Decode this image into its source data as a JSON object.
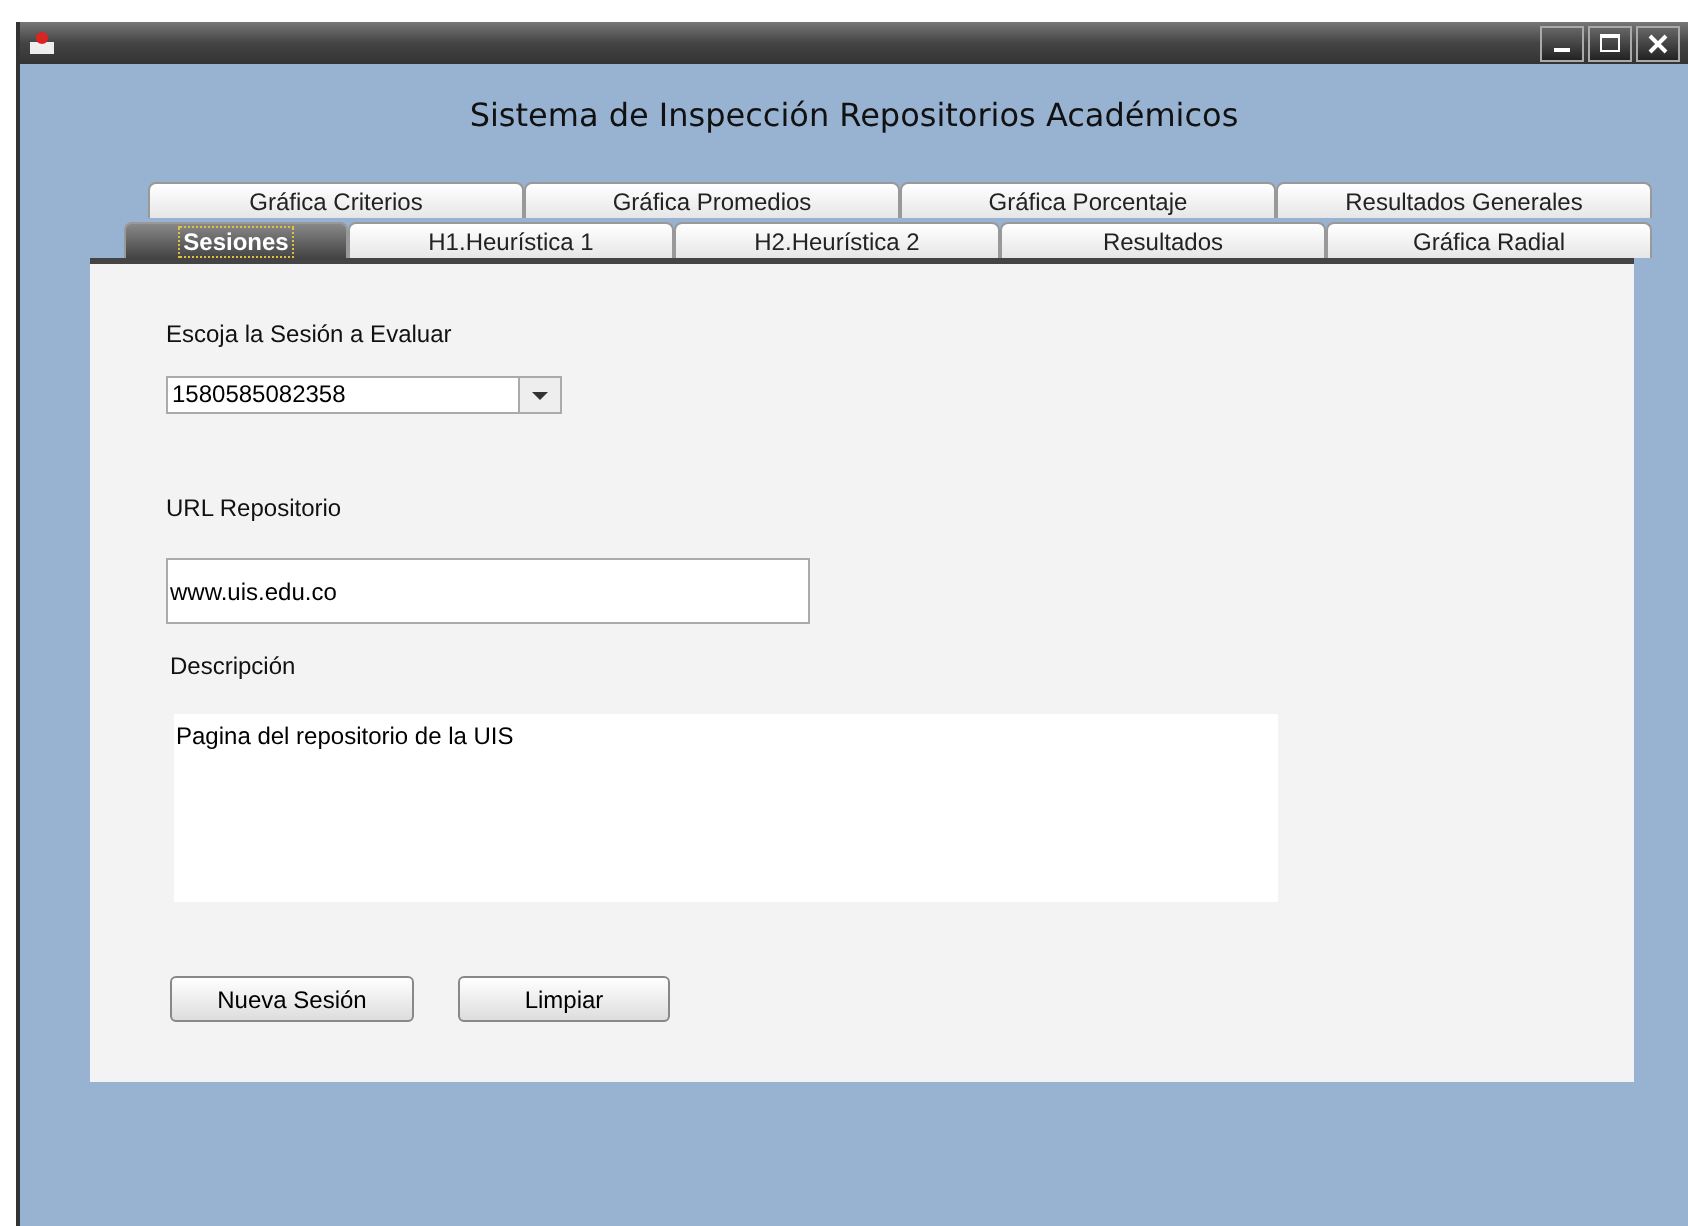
{
  "window": {
    "title": "Sistema de Inspección Repositorios Académicos"
  },
  "tab_rows": [
    [
      {
        "label": "Gráfica Criterios",
        "selected": false
      },
      {
        "label": "Gráfica Promedios",
        "selected": false
      },
      {
        "label": "Gráfica Porcentaje",
        "selected": false
      },
      {
        "label": "Resultados Generales",
        "selected": false
      }
    ],
    [
      {
        "label": "Sesiones",
        "selected": true
      },
      {
        "label": "H1.Heurística 1",
        "selected": false
      },
      {
        "label": "H2.Heurística 2",
        "selected": false
      },
      {
        "label": "Resultados",
        "selected": false
      },
      {
        "label": "Gráfica Radial",
        "selected": false
      }
    ]
  ],
  "session": {
    "label": "Escoja la Sesión a Evaluar",
    "value": "1580585082358"
  },
  "url": {
    "label": "URL Repositorio",
    "value": "www.uis.edu.co"
  },
  "description": {
    "label": "Descripción",
    "value": "Pagina del repositorio de la UIS"
  },
  "buttons": [
    "Nueva Sesión",
    "Limpiar"
  ]
}
